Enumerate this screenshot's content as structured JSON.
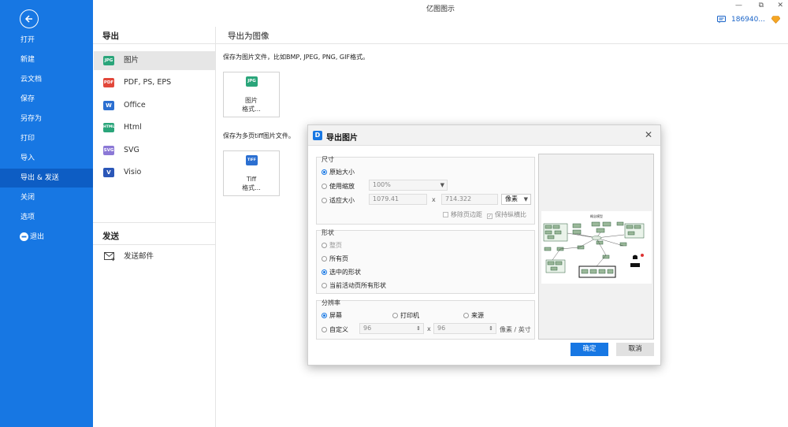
{
  "window": {
    "title": "亿图图示",
    "user_id": "186940...",
    "restore_glyph": "⧉",
    "minimize_glyph": "—",
    "close_glyph": "✕"
  },
  "sidebar": {
    "items": [
      "打开",
      "新建",
      "云文档",
      "保存",
      "另存为",
      "打印",
      "导入",
      "导出 & 发送",
      "关闭",
      "选项",
      "退出"
    ],
    "active": "导出 & 发送"
  },
  "left_panel": {
    "export_title": "导出",
    "formats": [
      {
        "label": "图片",
        "icon": "JPG",
        "color": "#2aa57a"
      },
      {
        "label": "PDF, PS, EPS",
        "icon": "PDF",
        "color": "#e2473a"
      },
      {
        "label": "Office",
        "icon": "W",
        "color": "#2b6fd1"
      },
      {
        "label": "Html",
        "icon": "HTML",
        "color": "#2aa57a"
      },
      {
        "label": "SVG",
        "icon": "SVG",
        "color": "#8b78d6"
      },
      {
        "label": "Visio",
        "icon": "V",
        "color": "#2b57b8"
      }
    ],
    "send_title": "发送",
    "send_mail": "发送邮件"
  },
  "main": {
    "title": "导出为图像",
    "desc_image": "保存为图片文件，比如BMP, JPEG, PNG, GIF格式。",
    "card_image_icon": "JPG",
    "card_image_line1": "图片",
    "card_image_line2": "格式...",
    "desc_tiff": "保存为多页tiff图片文件。",
    "card_tiff_icon": "TIFF",
    "card_tiff_line1": "Tiff",
    "card_tiff_line2": "格式..."
  },
  "dialog": {
    "title": "导出图片",
    "size_group": "尺寸",
    "opt_original": "原始大小",
    "opt_zoom": "使用缩放",
    "zoom_value": "100%",
    "opt_fit": "适应大小",
    "width_value": "1079.41",
    "times": "x",
    "height_value": "714.322",
    "unit_value": "像素",
    "chk_margin": "移除页边距",
    "chk_ratio": "保持纵横比",
    "shape_group": "形状",
    "opt_whole": "整页",
    "opt_all_pages": "所有页",
    "opt_selected": "选中的形状",
    "opt_active_all": "当前活动页所有形状",
    "res_group": "分辨率",
    "opt_screen": "屏幕",
    "opt_printer": "打印机",
    "opt_source": "来源",
    "opt_custom": "自定义",
    "dpi_x": "96",
    "dpi_y": "96",
    "dpi_unit": "像素 / 英寸",
    "ok": "确定",
    "cancel": "取消",
    "preview_title": "概念模型"
  },
  "colors": {
    "brand": "#1777e3",
    "sidebar_active": "#0d5dc4"
  }
}
